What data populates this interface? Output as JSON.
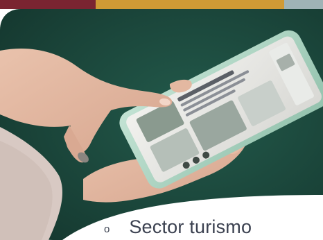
{
  "colors": {
    "top_bar_maroon": "#7a2431",
    "top_bar_gold": "#cf9a35",
    "top_bar_slate": "#9fb3b6",
    "photo_background": "#1d4a3e",
    "phone_body": "#a9d3c0",
    "caption_text": "#3b4150"
  },
  "photo": {
    "subject": "phone-in-hands-photo"
  },
  "caption": {
    "bullet": "o",
    "text": "Sector turismo"
  }
}
